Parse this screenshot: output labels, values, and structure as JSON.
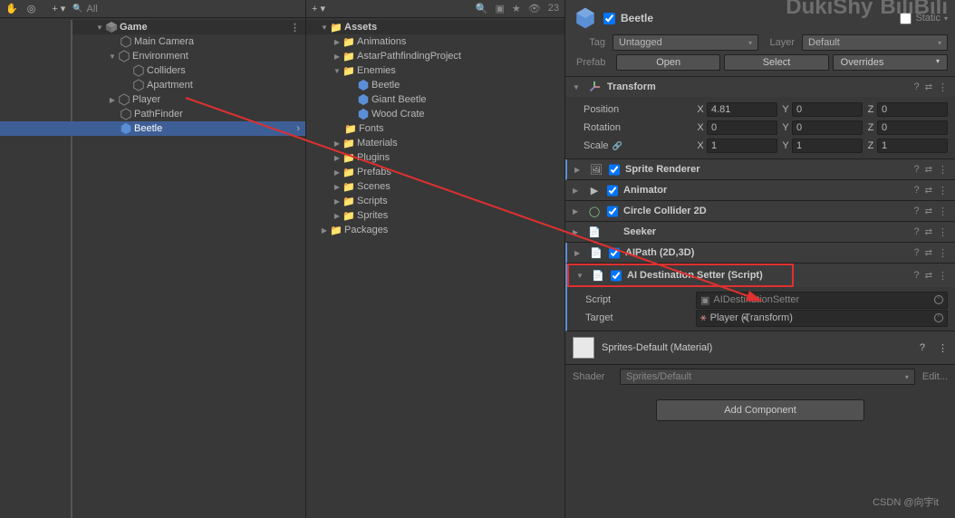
{
  "hierarchy": {
    "search_placeholder": "All",
    "scene": "Game",
    "items": [
      {
        "label": "Main Camera"
      },
      {
        "label": "Environment"
      },
      {
        "label": "Colliders"
      },
      {
        "label": "Apartment"
      },
      {
        "label": "Player"
      },
      {
        "label": "PathFinder"
      },
      {
        "label": "Beetle"
      }
    ]
  },
  "project": {
    "hidden_count": "23",
    "root": "Assets",
    "folders": [
      "Animations",
      "AstarPathfindingProject",
      "Enemies",
      "Fonts",
      "Materials",
      "Plugins",
      "Prefabs",
      "Scenes",
      "Scripts",
      "Sprites"
    ],
    "enemies": [
      "Beetle",
      "Giant Beetle",
      "Wood Crate"
    ],
    "packages": "Packages"
  },
  "inspector": {
    "name": "Beetle",
    "static_label": "Static",
    "tag_label": "Tag",
    "tag_value": "Untagged",
    "layer_label": "Layer",
    "layer_value": "Default",
    "prefab_label": "Prefab",
    "prefab_open": "Open",
    "prefab_select": "Select",
    "prefab_overrides": "Overrides",
    "transform": {
      "title": "Transform",
      "position_label": "Position",
      "rotation_label": "Rotation",
      "scale_label": "Scale",
      "px": "4.81",
      "py": "0",
      "pz": "0",
      "rx": "0",
      "ry": "0",
      "rz": "0",
      "sx": "1",
      "sy": "1",
      "sz": "1"
    },
    "components": {
      "sprite_renderer": "Sprite Renderer",
      "animator": "Animator",
      "circle_collider": "Circle Collider 2D",
      "seeker": "Seeker",
      "aipath": "AIPath (2D,3D)",
      "aidest": "AI Destination Setter (Script)"
    },
    "aidest_props": {
      "script_label": "Script",
      "script_value": "AIDestinationSetter",
      "target_label": "Target",
      "target_value": "Player (Transform)"
    },
    "material": {
      "name": "Sprites-Default (Material)",
      "shader_label": "Shader",
      "shader_value": "Sprites/Default",
      "edit": "Edit..."
    },
    "add_component": "Add Component"
  },
  "watermark_main": "CSDN @向宇it",
  "watermark_tl": "DukiShy",
  "watermark_tr": "BiliBili"
}
